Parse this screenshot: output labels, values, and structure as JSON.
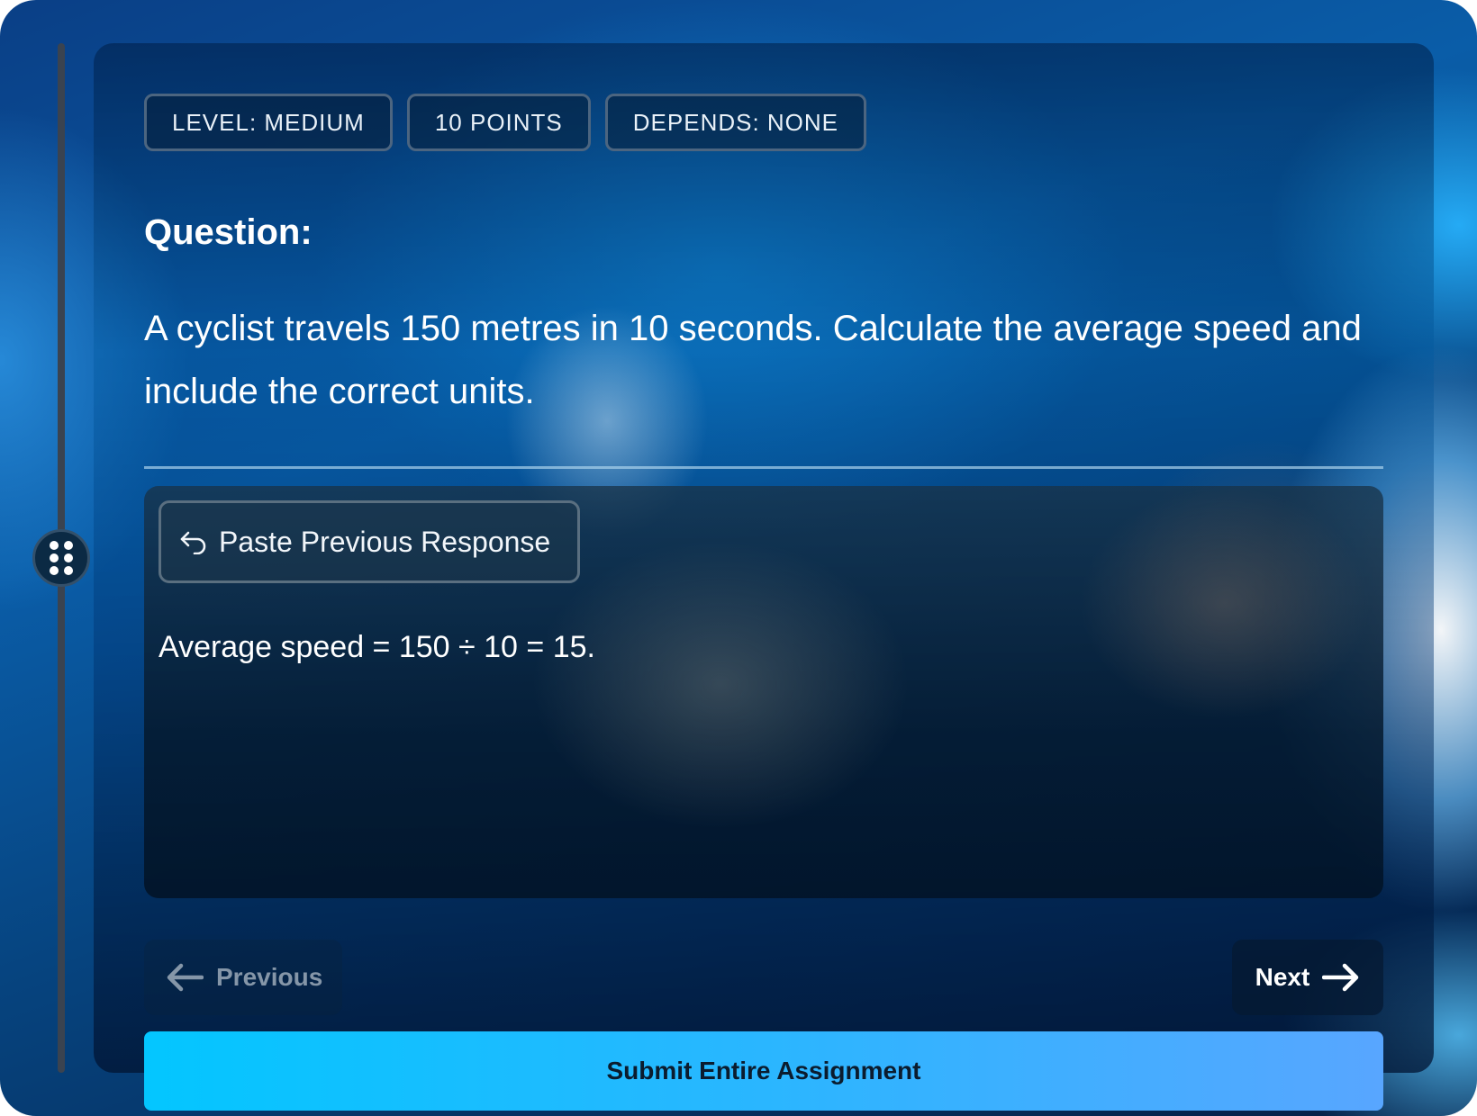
{
  "badges": {
    "level": "LEVEL:  MEDIUM",
    "points": "10  POINTS",
    "depends": "DEPENDS:  NONE"
  },
  "question": {
    "title": "Question:",
    "text": "A cyclist travels 150 metres in 10 seconds. Calculate the average speed and include the correct units."
  },
  "answer": {
    "paste_label": "Paste Previous Response",
    "text": "Average speed = 150 ÷ 10 = 15."
  },
  "nav": {
    "previous_label": "Previous",
    "next_label": "Next"
  },
  "submit": {
    "label": "Submit Entire Assignment"
  },
  "icons": {
    "handle": "drag-dots-icon",
    "paste": "return-arrow-icon",
    "previous": "arrow-left-icon",
    "next": "arrow-right-icon"
  },
  "colors": {
    "submit_start": "#03c6ff",
    "submit_end": "#58a6ff",
    "badge_border": "#4c6580"
  }
}
